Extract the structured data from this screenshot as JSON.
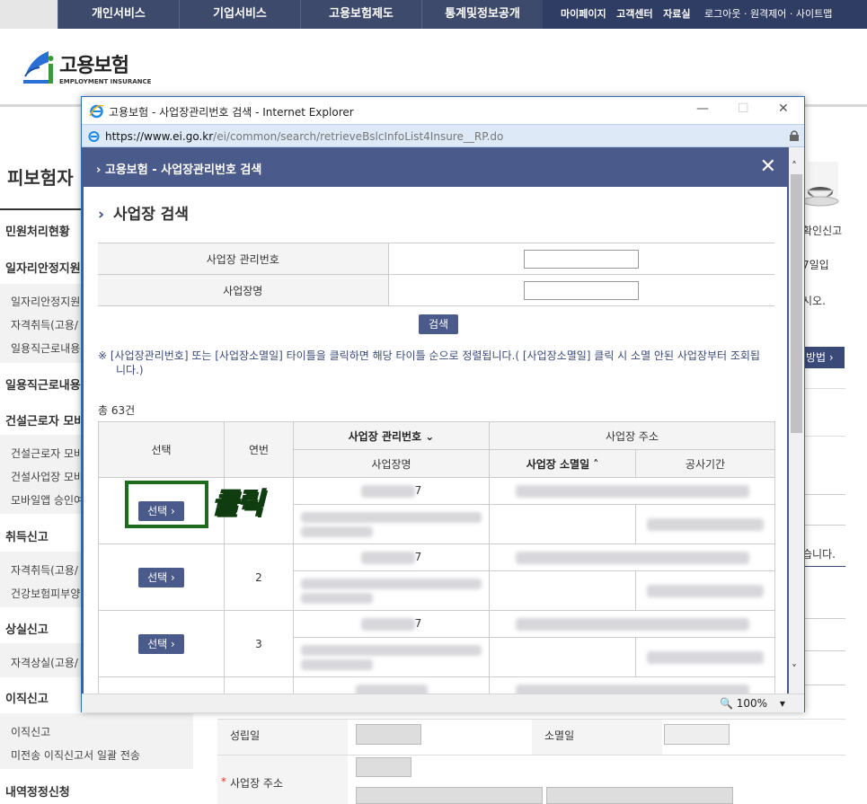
{
  "topnav": {
    "menu": [
      "개인서비스",
      "기업서비스",
      "고용보험제도",
      "통계및정보공개"
    ],
    "util_bold": [
      "마이페이지",
      "고객센터",
      "자료실"
    ],
    "util_links": "로그아웃 · 원격제어 · 사이트맵"
  },
  "logo": {
    "kr": "고용보험",
    "en": "EMPLOYMENT INSURANCE"
  },
  "page_title": "피보험자",
  "sidebar": [
    {
      "type": "h",
      "label": "민원처리현황"
    },
    {
      "type": "h",
      "label": "일자리안정지원"
    },
    {
      "type": "s",
      "label": "일자리안정지원"
    },
    {
      "type": "s",
      "label": "자격취득(고용/"
    },
    {
      "type": "s",
      "label": "일용직근로내용"
    },
    {
      "type": "h",
      "label": "일용직근로내용"
    },
    {
      "type": "h",
      "label": "건설근로자 모바"
    },
    {
      "type": "s",
      "label": "건설근로자 모바"
    },
    {
      "type": "s",
      "label": "건설사업장 모바"
    },
    {
      "type": "s",
      "label": "모바일앱 승인여"
    },
    {
      "type": "h",
      "label": "취득신고"
    },
    {
      "type": "s",
      "label": "자격취득(고용/"
    },
    {
      "type": "s",
      "label": "건강보험피부양"
    },
    {
      "type": "h",
      "label": "상실신고"
    },
    {
      "type": "s",
      "label": "자격상실(고용/"
    },
    {
      "type": "h",
      "label": "이직신고"
    },
    {
      "type": "s",
      "label": "이직신고"
    },
    {
      "type": "s",
      "label": "미전송 이직신고서 일괄 전송"
    },
    {
      "type": "h",
      "label": "내역정정신청"
    }
  ],
  "right_fragments": {
    "t1": "확인신고",
    "t2": "7일입",
    "t3": "시오.",
    "btn": "방법 ›",
    "t4": "습니다."
  },
  "form": {
    "established_label": "성립일",
    "closed_label": "소멸일",
    "address_label": "사업장 주소",
    "required_mark": "*"
  },
  "popup": {
    "window_title": "고용보험 - 사업장관리번호 검색 - Internet Explorer",
    "url_domain": "https://www.ei.go.kr",
    "url_path": "/ei/common/search/retrieveBslcInfoList4Insure__RP.do",
    "dialog_title": "고용보험 - 사업장관리번호 검색",
    "close_label": "✕",
    "section_title": "사업장 검색",
    "search_fields": [
      {
        "label": "사업장 관리번호",
        "value": ""
      },
      {
        "label": "사업장명",
        "value": ""
      }
    ],
    "search_button": "검색",
    "notice": "※ [사업장관리번호] 또는 [사업장소멸일] 타이틀을 클릭하면 해당 타이틀 순으로 정렬됩니다.( [사업장소멸일] 클릭 시 소멸 안된 사업장부터 조회됩니다.)",
    "total_count": "총 63건",
    "table_headers": {
      "select": "선택",
      "seq": "연번",
      "mgmt_no": "사업장 관리번호 ⌄",
      "address": "사업장 주소",
      "name": "사업장명",
      "closed_date": "사업장 소멸일 ˄",
      "period": "공사기간"
    },
    "rows": [
      {
        "select_label": "선택 ›",
        "seq": "",
        "mgmt_suffix": "7"
      },
      {
        "select_label": "선택 ›",
        "seq": "2",
        "mgmt_suffix": "7"
      },
      {
        "select_label": "선택 ›",
        "seq": "3",
        "mgmt_suffix": "7"
      }
    ],
    "annotation": "클릭",
    "zoom": "🔍 100%",
    "zoom_arrow": "▾"
  }
}
